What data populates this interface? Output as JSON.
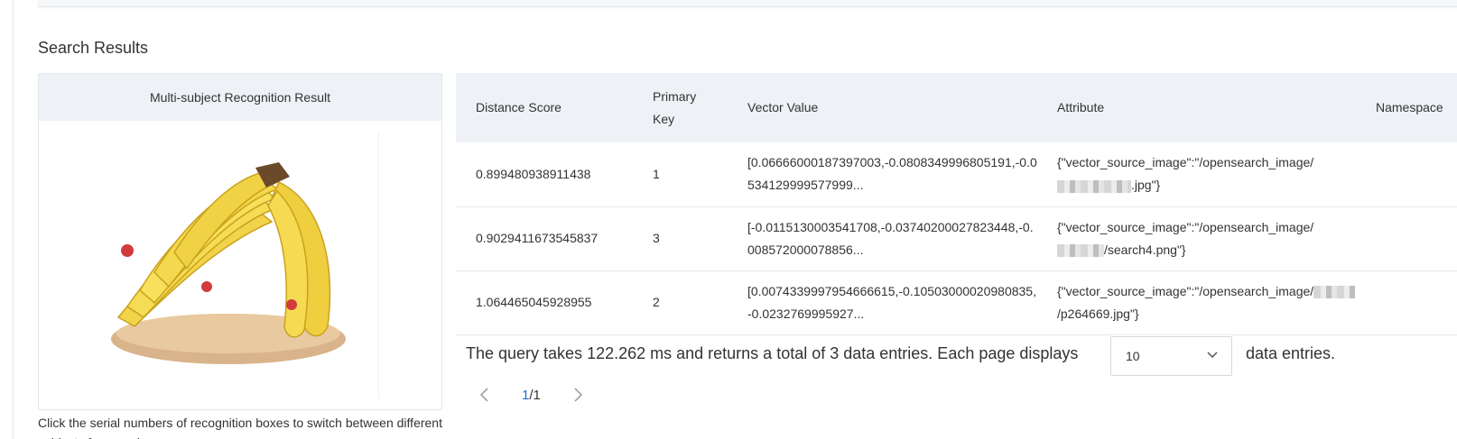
{
  "section_title": "Search Results",
  "recognition": {
    "header": "Multi-subject Recognition Result",
    "image_icon": "banana-bunch-image",
    "hint": "Click the serial numbers of recognition boxes to switch between different subjects for search."
  },
  "table": {
    "headers": [
      "Distance Score",
      "Primary Key",
      "Vector Value",
      "Attribute",
      "Namespace"
    ],
    "rows": [
      {
        "score": "0.899480938911438",
        "key": "1",
        "vector": "[0.06666000187397003,-0.0808349996805191,-0.0534129999577999...",
        "attr_prefix": "{\"vector_source_image\":\"/opensearch_image/",
        "attr_suffix": ".jpg\"}",
        "namespace": ""
      },
      {
        "score": "0.9029411673545837",
        "key": "3",
        "vector": "[-0.0115130003541708,-0.03740200027823448,-0.008572000078856...",
        "attr_prefix": "{\"vector_source_image\":\"/opensearch_image/",
        "attr_suffix": "/search4.png\"}",
        "namespace": ""
      },
      {
        "score": "1.064465045928955",
        "key": "2",
        "vector": "[0.0074339997954666615,-0.10503000020980835,-0.0232769995927...",
        "attr_prefix": "{\"vector_source_image\":\"/opensearch_image/",
        "attr_suffix": "/p264669.jpg\"}",
        "namespace": ""
      }
    ]
  },
  "footer": {
    "summary": "The query takes 122.262 ms and returns a total of 3 data entries. Each page displays",
    "page_size": "10",
    "tail": "data entries."
  },
  "pagination": {
    "current": "1",
    "total": "/1",
    "prev_icon": "chevron-left-icon",
    "next_icon": "chevron-right-icon"
  },
  "colors": {
    "header_bg": "#eef1f5",
    "accent": "#1e6fd9",
    "border": "#e8eaed"
  }
}
